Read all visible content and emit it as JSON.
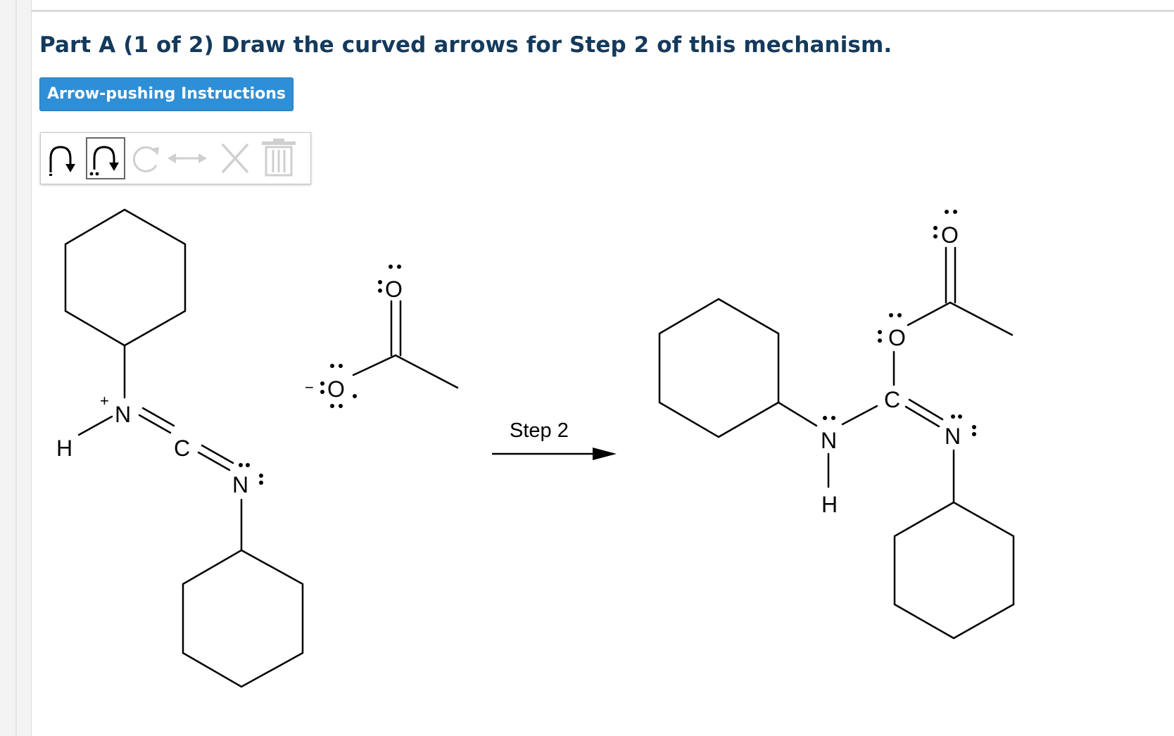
{
  "question": {
    "title": "Part A (1 of 2) Draw the curved arrows for Step 2 of this mechanism.",
    "instructions_button": "Arrow-pushing Instructions"
  },
  "toolbar": {
    "tools": [
      {
        "icon": "single-curved-arrow-icon",
        "selected": false
      },
      {
        "icon": "lone-pair-curved-arrow-icon",
        "selected": true
      },
      {
        "icon": "circular-arrow-icon",
        "selected": false
      },
      {
        "icon": "resonance-arrow-icon",
        "selected": false
      },
      {
        "icon": "delete-x-icon",
        "selected": false
      },
      {
        "icon": "trash-icon",
        "selected": false
      }
    ]
  },
  "mechanism": {
    "step_label": "Step 2",
    "atoms": {
      "N": "N",
      "C": "C",
      "O": "O",
      "H": "H",
      "plus": "+",
      "minus": "−"
    }
  }
}
